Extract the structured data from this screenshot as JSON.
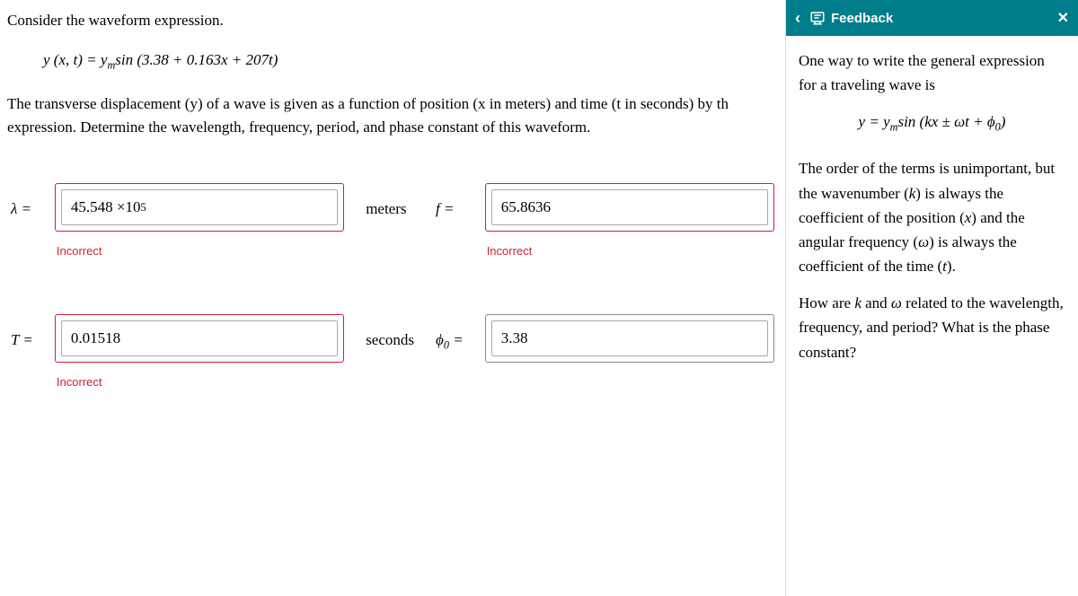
{
  "question": {
    "intro": "Consider the waveform expression.",
    "equation_html": "<span class='ital'>y</span> (<span class='ital'>x</span>, <span class='ital'>t</span>) = <span class='ital'>y</span><sub>m</sub>sin (3.38 + 0.163<span class='ital'>x</span> + 207<span class='ital'>t</span>)",
    "body": "The transverse displacement (y) of a wave is given as a function of position (x in meters) and time (t in seconds) by th expression. Determine the wavelength, frequency, period, and phase constant of this waveform."
  },
  "answers": {
    "lambda": {
      "label_html": "<span class='ital'>λ</span> =",
      "value_html": "45.548 ×10<sup>5</sup>",
      "unit": "meters",
      "status": "Incorrect",
      "correct": false
    },
    "f": {
      "label_html": "<span class='ital'>f</span> =",
      "value": "65.8636",
      "unit": "",
      "status": "Incorrect",
      "correct": false
    },
    "T": {
      "label_html": "<span class='ital'>T</span> =",
      "value": "0.01518",
      "unit": "seconds",
      "status": "Incorrect",
      "correct": false
    },
    "phi0": {
      "label_html": "<span class='ital'>ϕ</span><sub>0</sub> =",
      "value": "3.38",
      "unit": "",
      "status": "",
      "correct": true
    }
  },
  "sidebar": {
    "title": "Feedback",
    "p1": "One way to write the general expression for a traveling wave is",
    "eq_html": "<span class='ital'>y</span> = <span class='ital'>y</span><sub>m</sub>sin (<span class='ital'>kx</span> ± <span class='ital'>ωt</span> + <span class='ital'>ϕ</span><sub>0</sub>)",
    "p2_html": "The order of the terms is unimportant, but the wavenumber (<span class='ital'>k</span>) is always the coefficient of the position (<span class='ital'>x</span>) and the angular frequency (<span class='ital'>ω</span>) is always the coefficient of the time (<span class='ital'>t</span>).",
    "p3_html": "How are <span class='ital'>k</span> and <span class='ital'>ω</span> related to the wavelength, frequency, and period? What is the phase constant?"
  }
}
